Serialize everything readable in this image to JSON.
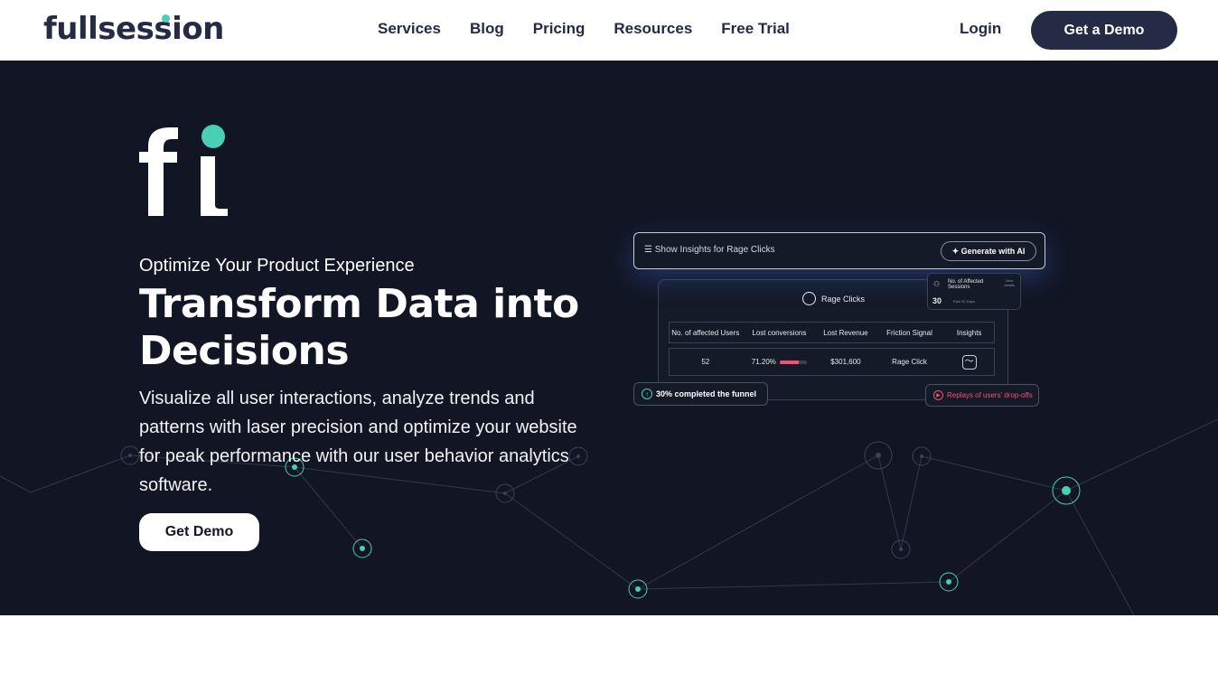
{
  "nav": {
    "logo": "fullsession",
    "links": [
      "Services",
      "Blog",
      "Pricing",
      "Resources",
      "Free Trial"
    ],
    "login": "Login",
    "demo": "Get a Demo"
  },
  "hero": {
    "eyebrow": "Optimize Your Product Experience",
    "headline": "Transform Data into Decisions",
    "description": "Visualize all user interactions, analyze trends and patterns with laser precision and optimize your website for peak performance with our user behavior analytics software.",
    "cta": "Get Demo"
  },
  "dashboard": {
    "query": "Show Insights  for Rage Clicks",
    "ai_button": "Generate with AI",
    "title": "Rage Clicks",
    "columns": [
      "No. of affected Users",
      "Lost conversions",
      "Lost Revenue",
      "Friction Signal",
      "Insights"
    ],
    "row": {
      "users": "52",
      "conversions": "71.20%",
      "conversion_fraction": 0.71,
      "revenue": "$301,600",
      "signal": "Rage Click"
    },
    "affected": {
      "title": "No. of Affected Sessions",
      "value": "30",
      "period": "Past 30 Days",
      "view": "View details"
    },
    "funnel": "30% completed the funnel",
    "replays": "Replays of users' drop-offs"
  },
  "colors": {
    "brand_dark": "#262b45",
    "accent": "#49cfb4",
    "hero_bg": "#121624",
    "alert": "#f05272"
  }
}
